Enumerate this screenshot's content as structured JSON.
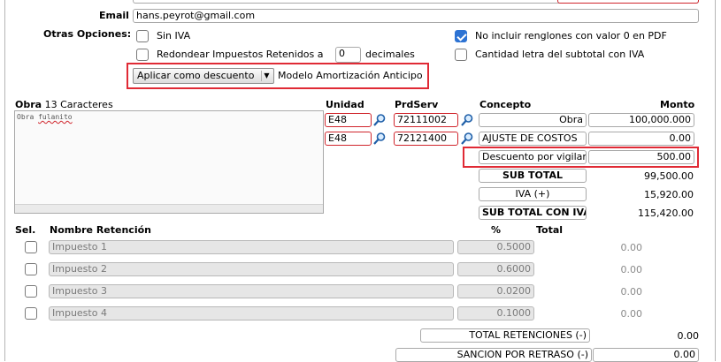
{
  "form": {
    "email_label": "Email",
    "email_value": "hans.peyrot@gmail.com",
    "otras_opciones_label": "Otras Opciones:",
    "sin_iva_label": "Sin IVA",
    "redondear_label": "Redondear Impuestos Retenidos a",
    "redondear_value": "0",
    "decimales_label": "decimales",
    "no_incluir_label": "No incluir renglones con valor 0 en PDF",
    "cantidad_letra_label": "Cantidad letra del subtotal con IVA",
    "descuento_select_value": "Aplicar como descuento",
    "modelo_label": "Modelo Amortización Anticipo"
  },
  "items": {
    "obra_label": "Obra",
    "caracteres_count": "13",
    "caracteres_label": "Caracteres",
    "obra_text_word1": "Obra",
    "obra_text_word2": "fulanito",
    "unidad_header": "Unidad",
    "prodserv_header": "PrdServ",
    "concepto_header": "Concepto",
    "monto_header": "Monto",
    "rows": [
      {
        "unidad": "E48",
        "prodserv": "72111002",
        "concepto": "Obra",
        "monto": "100,000.000"
      },
      {
        "unidad": "E48",
        "prodserv": "72121400",
        "concepto": "AJUSTE DE COSTOS",
        "monto": "0.00"
      }
    ],
    "descuento_concepto": "Descuento por vigilan",
    "descuento_monto": "500.00"
  },
  "totals": {
    "subtotal_label": "SUB TOTAL",
    "subtotal_value": "99,500.00",
    "iva_label": "IVA (+)",
    "iva_value": "15,920.00",
    "subtotal_iva_label": "SUB TOTAL CON IVA",
    "subtotal_iva_value": "115,420.00"
  },
  "retenciones": {
    "sel_header": "Sel.",
    "nombre_header": "Nombre Retención",
    "pct_header": "%",
    "total_header": "Total",
    "rows": [
      {
        "nombre": "Impuesto 1",
        "pct": "0.5000",
        "total": "0.00"
      },
      {
        "nombre": "Impuesto 2",
        "pct": "0.6000",
        "total": "0.00"
      },
      {
        "nombre": "Impuesto 3",
        "pct": "0.0200",
        "total": "0.00"
      },
      {
        "nombre": "Impuesto 4",
        "pct": "0.1000",
        "total": "0.00"
      }
    ],
    "total_retenciones_label": "TOTAL RETENCIONES (-)",
    "total_retenciones_value": "0.00",
    "sancion_label": "SANCION POR RETRASO (-)",
    "sancion_value": "0.00"
  },
  "colors": {
    "highlight_red": "#e02a35",
    "checkbox_blue": "#2d73d3"
  }
}
